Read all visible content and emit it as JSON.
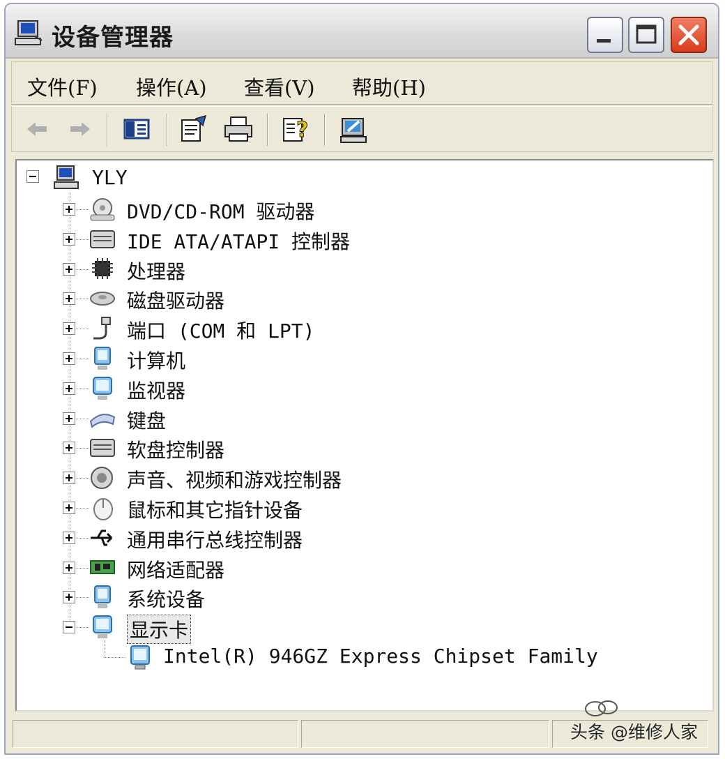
{
  "window": {
    "title": "设备管理器"
  },
  "menu": [
    "文件(F)",
    "操作(A)",
    "查看(V)",
    "帮助(H)"
  ],
  "tree": {
    "root": "YLY",
    "categories": [
      {
        "label": "DVD/CD-ROM 驱动器",
        "icon": "cdrom-icon",
        "expanded": false
      },
      {
        "label": "IDE ATA/ATAPI 控制器",
        "icon": "ide-controller-icon",
        "expanded": false
      },
      {
        "label": "处理器",
        "icon": "processor-icon",
        "expanded": false
      },
      {
        "label": "磁盘驱动器",
        "icon": "disk-drive-icon",
        "expanded": false
      },
      {
        "label": "端口 (COM 和 LPT)",
        "icon": "port-icon",
        "expanded": false
      },
      {
        "label": "计算机",
        "icon": "computer-icon",
        "expanded": false
      },
      {
        "label": "监视器",
        "icon": "monitor-icon",
        "expanded": false
      },
      {
        "label": "键盘",
        "icon": "keyboard-icon",
        "expanded": false
      },
      {
        "label": "软盘控制器",
        "icon": "floppy-controller-icon",
        "expanded": false
      },
      {
        "label": "声音、视频和游戏控制器",
        "icon": "sound-icon",
        "expanded": false
      },
      {
        "label": "鼠标和其它指针设备",
        "icon": "mouse-icon",
        "expanded": false
      },
      {
        "label": "通用串行总线控制器",
        "icon": "usb-icon",
        "expanded": false
      },
      {
        "label": "网络适配器",
        "icon": "network-adapter-icon",
        "expanded": false
      },
      {
        "label": "系统设备",
        "icon": "system-device-icon",
        "expanded": false
      },
      {
        "label": "显示卡",
        "icon": "display-adapter-icon",
        "expanded": true,
        "selected": true
      }
    ],
    "child": "Intel(R)  946GZ Express Chipset Family"
  },
  "watermark": "头条 @维修人家",
  "colors": {
    "window_frame": "#ece9d8",
    "close_button": "#d93c1e"
  }
}
